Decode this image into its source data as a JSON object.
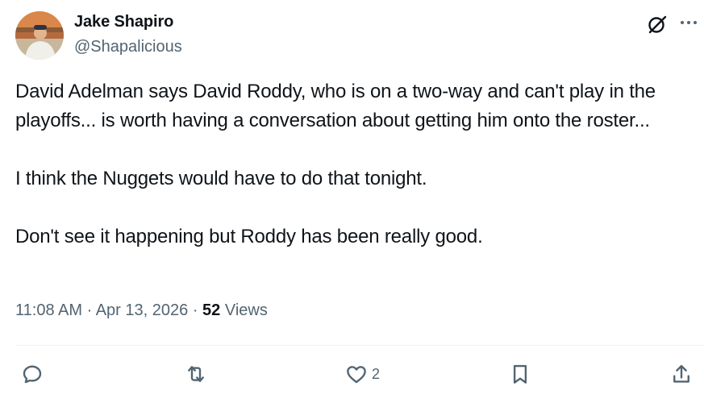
{
  "author": {
    "display_name": "Jake Shapiro",
    "handle": "@Shapalicious"
  },
  "tweet": {
    "paragraphs": [
      "David Adelman says David Roddy, who is on a two-way and can't play in the playoffs... is worth having a conversation about getting him onto the roster...",
      "I think the Nuggets would have to do that tonight.",
      "Don't see it happening but Roddy has been really good."
    ]
  },
  "meta": {
    "time": "11:08 AM",
    "separator": "·",
    "date": "Apr 13, 2026",
    "views_count": "52",
    "views_label": "Views"
  },
  "actions": {
    "reply": {
      "icon": "reply-icon",
      "count": ""
    },
    "repost": {
      "icon": "repost-icon",
      "count": ""
    },
    "like": {
      "icon": "heart-icon",
      "count": "2"
    },
    "bookmark": {
      "icon": "bookmark-icon",
      "count": ""
    },
    "share": {
      "icon": "share-icon",
      "count": ""
    }
  },
  "colors": {
    "text_primary": "#0f1419",
    "text_secondary": "#536471",
    "divider": "#eff3f4"
  }
}
